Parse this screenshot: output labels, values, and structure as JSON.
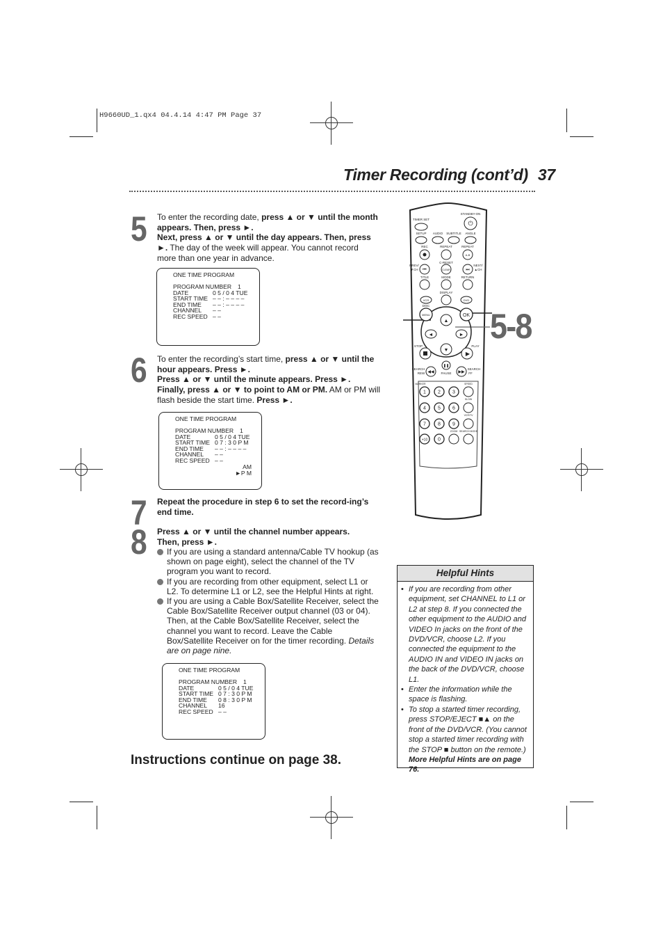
{
  "slug": "H9660UD_1.qx4  04.4.14  4:47 PM  Page 37",
  "header": {
    "title": "Timer Recording (cont’d)",
    "page_number": "37"
  },
  "steps": [
    {
      "number": "5",
      "parts": [
        {
          "t": "To enter the recording date, ",
          "b": false
        },
        {
          "t": "press ▲ or ▼ until the month appears. Then, press ►.",
          "b": true
        },
        {
          "t": "\nNext, press ▲ or ▼ until the day appears. Then, press ►.",
          "b": true
        },
        {
          "t": " The day of the week will appear. You cannot record more than one year in advance.",
          "b": false
        }
      ],
      "screen": {
        "heading": "ONE TIME PROGRAM",
        "rows": [
          {
            "label": "PROGRAM NUMBER",
            "value": "1"
          },
          {
            "label": "DATE",
            "value": "0 5 / 0 4  TUE"
          },
          {
            "label": "START TIME",
            "value": "– – : – –  – –"
          },
          {
            "label": "END   TIME",
            "value": "– – : – –  – –"
          },
          {
            "label": "CHANNEL",
            "value": "– –"
          },
          {
            "label": "REC SPEED",
            "value": "– –"
          }
        ],
        "flashing": "DATE day"
      }
    },
    {
      "number": "6",
      "parts": [
        {
          "t": "To enter the recording’s start time, ",
          "b": false
        },
        {
          "t": "press ▲ or ▼ until the hour appears. Press ►.",
          "b": true
        },
        {
          "t": "\nPress ▲ or ▼ until the minute appears. Press ►.\nFinally, press ▲ or ▼ to point to AM or PM.",
          "b": true
        },
        {
          "t": "  AM or PM will flash beside the start time. ",
          "b": false
        },
        {
          "t": "Press ►.",
          "b": true
        }
      ],
      "screen": {
        "heading": "ONE TIME PROGRAM",
        "rows": [
          {
            "label": "PROGRAM NUMBER",
            "value": "1"
          },
          {
            "label": "DATE",
            "value": "0 5 / 0 4  TUE"
          },
          {
            "label": "START TIME",
            "value": "0 7 : 3 0  P M"
          },
          {
            "label": "END   TIME",
            "value": "– – : – –  – –"
          },
          {
            "label": "CHANNEL",
            "value": "– –"
          },
          {
            "label": "REC SPEED",
            "value": "– –"
          }
        ],
        "ampm": [
          "AM",
          "►P M"
        ],
        "flashing": "START TIME PM"
      }
    },
    {
      "number": "7",
      "parts": [
        {
          "t": "Repeat the procedure in step 6 to set the record-ing’s end time.",
          "b": true
        }
      ]
    },
    {
      "number": "8",
      "parts": [
        {
          "t": "Press ▲ or ▼ until the channel number appears. Then, press ►.",
          "b": true
        }
      ],
      "bullets": [
        {
          "text": "If you are using a standard antenna/Cable TV hookup (as shown on page eight), select the channel of the TV program you want to record.",
          "italic_tail": ""
        },
        {
          "text": "If you are recording from other equipment, select L1 or L2. To determine L1 or L2, see the Helpful Hints at right.",
          "italic_tail": ""
        },
        {
          "text": "If you are using a Cable Box/Satellite Receiver, select the Cable Box/Satellite Receiver output channel (03 or 04). Then, at the Cable Box/Satellite Receiver, select the channel you want to record. Leave the Cable Box/Satellite Receiver on for the timer recording. ",
          "italic_tail": "Details are on page nine."
        }
      ],
      "screen": {
        "heading": "ONE TIME PROGRAM",
        "rows": [
          {
            "label": "PROGRAM NUMBER",
            "value": "1"
          },
          {
            "label": "DATE",
            "value": "0 5 / 0 4  TUE"
          },
          {
            "label": "START TIME",
            "value": "0 7 : 3 0  P M"
          },
          {
            "label": "END   TIME",
            "value": "0 8 : 3 0  P M"
          },
          {
            "label": "CHANNEL",
            "value": "16"
          },
          {
            "label": "REC SPEED",
            "value": "– –"
          }
        ],
        "flashing": "REC SPEED"
      }
    }
  ],
  "continue_note": "Instructions continue on page 38.",
  "remote": {
    "callout": "5-8",
    "labels": {
      "timer_set": "TIMER SET",
      "standby_on": "STANDBY-ON",
      "setup": "SETUP",
      "audio": "AUDIO",
      "subtitle": "SUBTITLE",
      "angle": "ANGLE",
      "rec": "REC",
      "repeat": "REPEAT",
      "repeat2": "REPEAT",
      "ab": "A-B",
      "prev": "PREV/",
      "prev_ch": "▼CH",
      "c_reset": "C-RESET",
      "clear": "CLEAR",
      "next": "NEXT/",
      "next_ch": "▲CH",
      "title": "TITLE",
      "mode": "MODE",
      "return": "RETURN",
      "display": "DISPLAY",
      "vcr": "VCR",
      "dvd": "DVD",
      "disc": "DISC",
      "menu": "MENU",
      "ok": "OK",
      "stop": "STOP",
      "play": "PLAY",
      "search_rew": "SEARCH",
      "rew": "REW",
      "pause": "PAUSE",
      "search_ff": "SEARCH",
      "ff": "FF",
      "marker": "MARKER",
      "speed": "SPEED",
      "slow": "SLOW",
      "vcr_tv": "VCR/TV",
      "zoom": "ZOOM",
      "search_mode": "SEARCH MODE",
      "digits": [
        "1",
        "2",
        "3",
        "4",
        "5",
        "6",
        "7",
        "8",
        "9",
        "+10",
        "0"
      ]
    }
  },
  "hints": {
    "title": "Helpful Hints",
    "items": [
      "If you are recording from other equipment, set CHANNEL to L1 or L2 at step 8. If you connected the other equipment to the AUDIO and VIDEO In jacks on the front of the DVD/VCR, choose L2. If you connected the equipment to the AUDIO IN and VIDEO IN jacks on the back of the DVD/VCR, choose L1.",
      "Enter the information while the space is flashing.",
      "To stop a started timer recording, press STOP/EJECT ■▲ on the front of the DVD/VCR. (You cannot stop a started timer recording with the STOP ■ button on the remote.)"
    ],
    "more": "More Helpful Hints are on page 76."
  }
}
